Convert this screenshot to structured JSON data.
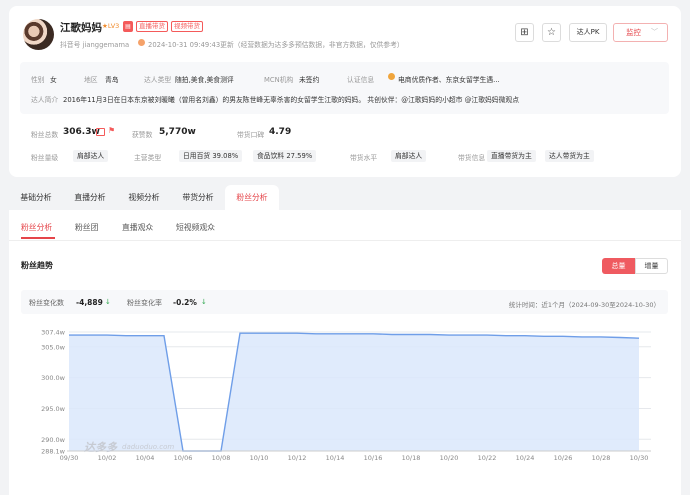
{
  "profile": {
    "name": "江歌妈妈",
    "level": "LV3",
    "tag_live": "直播带货",
    "tag_video": "视频带货",
    "douyin_id": "抖音号 jianggemama",
    "updated": "2024-10-31 09:49:43更新（经营数据为达多多预估数据，非官方数据，仅供参考）",
    "pk_button": "达人PK",
    "watch_button": "监控",
    "info": {
      "gender_label": "性别",
      "gender": "女",
      "region_label": "地区",
      "region": "青岛",
      "type_label": "达人类型",
      "type": "随拍,美食,美食测评",
      "mcn_label": "MCN机构",
      "mcn": "未签约",
      "cert_label": "认证信息",
      "cert": "电商优质作者、东京女留学生遇...",
      "bio_label": "达人简介",
      "bio": "2016年11月3日在日本东京被刘暖曦（曾用名刘鑫）的男友陈世峰无辜杀害的女留学生江歌的妈妈。 共创伙伴：@江歌妈妈的小超市 @江歌妈妈微观点"
    },
    "stats": {
      "fans_label": "粉丝总数",
      "fans": "306.3w",
      "likes_label": "获赞数",
      "likes": "5,770w",
      "reputation_label": "带货口碑",
      "reputation": "4.79",
      "fans_level_label": "粉丝量级",
      "fans_level": "肩部达人",
      "category_label": "主营类型",
      "category_1": "日用百货 39.08%",
      "category_2": "食品饮料 27.59%",
      "sales_level_label": "带货水平",
      "sales_level": "肩部达人",
      "sales_info_label": "带货信息",
      "sales_info_1": "直播带货为主",
      "sales_info_2": "达人带货为主"
    }
  },
  "tabs": [
    "基础分析",
    "直播分析",
    "视频分析",
    "带货分析",
    "粉丝分析"
  ],
  "subtabs": [
    "粉丝分析",
    "粉丝团",
    "直播观众",
    "短视频观众"
  ],
  "section": {
    "title": "粉丝趋势",
    "toggle_total": "总量",
    "toggle_increment": "增量"
  },
  "summary": {
    "change_label": "粉丝变化数",
    "change_value": "-4,889",
    "rate_label": "粉丝变化率",
    "rate_value": "-0.2%",
    "time_range": "统计时间：近1个月（2024-09-30至2024-10-30）"
  },
  "watermark": "达多多",
  "watermark_domain": "daduoduo.com",
  "colors": {
    "accent": "#e5454a",
    "line": "#6f9ee8",
    "area": "#dbe8fb",
    "down": "#2fa84f"
  },
  "chart_data": {
    "type": "area",
    "title": "粉丝趋势",
    "x": [
      "09/30",
      "10/01",
      "10/02",
      "10/03",
      "10/04",
      "10/05",
      "10/06",
      "10/07",
      "10/08",
      "10/09",
      "10/10",
      "10/11",
      "10/12",
      "10/13",
      "10/14",
      "10/15",
      "10/16",
      "10/17",
      "10/18",
      "10/19",
      "10/20",
      "10/21",
      "10/22",
      "10/23",
      "10/24",
      "10/25",
      "10/26",
      "10/27",
      "10/28",
      "10/29",
      "10/30"
    ],
    "xticks": [
      "09/30",
      "10/02",
      "10/04",
      "10/06",
      "10/08",
      "10/10",
      "10/12",
      "10/14",
      "10/16",
      "10/18",
      "10/20",
      "10/22",
      "10/24",
      "10/26",
      "10/28",
      "10/30"
    ],
    "yticks": [
      "288.1w",
      "290.0w",
      "295.0w",
      "300.0w",
      "305.0w",
      "307.4w"
    ],
    "ylim": [
      288.1,
      307.4
    ],
    "values": [
      306.9,
      306.9,
      306.9,
      306.8,
      306.8,
      306.8,
      288.1,
      288.1,
      288.1,
      307.2,
      307.2,
      307.2,
      307.2,
      307.1,
      307.1,
      307.1,
      307.1,
      307.0,
      307.0,
      307.0,
      306.9,
      306.9,
      306.9,
      306.8,
      306.8,
      306.7,
      306.7,
      306.6,
      306.6,
      306.5,
      306.4
    ],
    "grid": true
  }
}
